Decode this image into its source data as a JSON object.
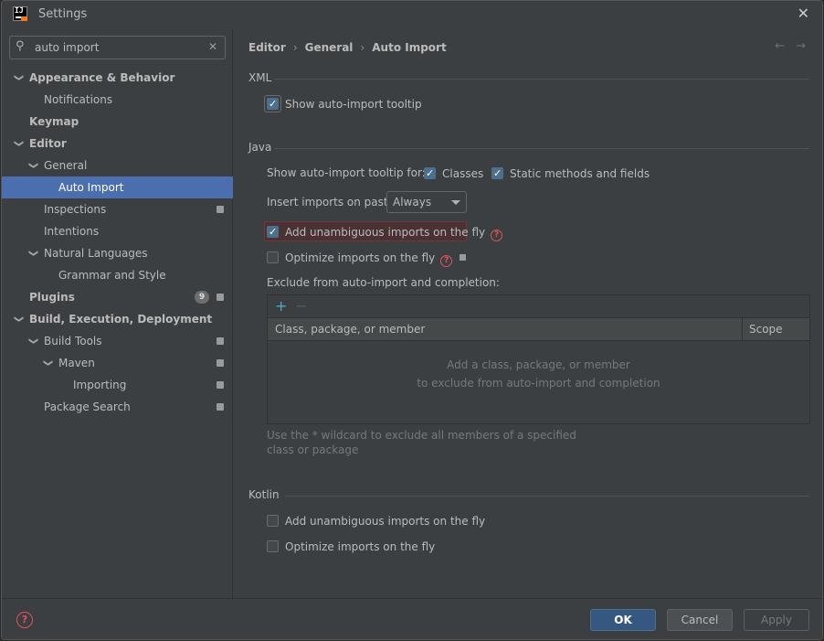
{
  "window": {
    "title": "Settings",
    "app_icon_text": "IJ"
  },
  "search": {
    "value": "auto import"
  },
  "tree": [
    {
      "label": "Appearance & Behavior",
      "bold": true,
      "chevron": true,
      "level": 0,
      "selected": false,
      "project": false,
      "badge": ""
    },
    {
      "label": "Notifications",
      "bold": false,
      "chevron": false,
      "level": 1,
      "selected": false,
      "project": false,
      "badge": ""
    },
    {
      "label": "Keymap",
      "bold": true,
      "chevron": false,
      "level": 0,
      "selected": false,
      "project": false,
      "badge": ""
    },
    {
      "label": "Editor",
      "bold": true,
      "chevron": true,
      "level": 0,
      "selected": false,
      "project": false,
      "badge": ""
    },
    {
      "label": "General",
      "bold": false,
      "chevron": true,
      "level": 1,
      "selected": false,
      "project": false,
      "badge": ""
    },
    {
      "label": "Auto Import",
      "bold": false,
      "chevron": false,
      "level": 2,
      "selected": true,
      "project": false,
      "badge": ""
    },
    {
      "label": "Inspections",
      "bold": false,
      "chevron": false,
      "level": 1,
      "selected": false,
      "project": true,
      "badge": ""
    },
    {
      "label": "Intentions",
      "bold": false,
      "chevron": false,
      "level": 1,
      "selected": false,
      "project": false,
      "badge": ""
    },
    {
      "label": "Natural Languages",
      "bold": false,
      "chevron": true,
      "level": 1,
      "selected": false,
      "project": false,
      "badge": ""
    },
    {
      "label": "Grammar and Style",
      "bold": false,
      "chevron": false,
      "level": 2,
      "selected": false,
      "project": false,
      "badge": ""
    },
    {
      "label": "Plugins",
      "bold": true,
      "chevron": false,
      "level": 0,
      "selected": false,
      "project": true,
      "badge": "9"
    },
    {
      "label": "Build, Execution, Deployment",
      "bold": true,
      "chevron": true,
      "level": 0,
      "selected": false,
      "project": false,
      "badge": ""
    },
    {
      "label": "Build Tools",
      "bold": false,
      "chevron": true,
      "level": 1,
      "selected": false,
      "project": true,
      "badge": ""
    },
    {
      "label": "Maven",
      "bold": false,
      "chevron": true,
      "level": 2,
      "selected": false,
      "project": true,
      "badge": ""
    },
    {
      "label": "Importing",
      "bold": false,
      "chevron": false,
      "level": 3,
      "selected": false,
      "project": true,
      "badge": ""
    },
    {
      "label": "Package Search",
      "bold": false,
      "chevron": false,
      "level": 1,
      "selected": false,
      "project": true,
      "badge": ""
    }
  ],
  "breadcrumb": {
    "items": [
      "Editor",
      "General",
      "Auto Import"
    ],
    "separator": "›"
  },
  "nav": {
    "back": "←",
    "forward": "→"
  },
  "xml": {
    "title": "XML",
    "show_tooltip": {
      "label": "Show auto-import tooltip",
      "checked": true
    }
  },
  "java": {
    "title": "Java",
    "tooltip_for_label": "Show auto-import tooltip for:",
    "classes": {
      "label": "Classes",
      "checked": true
    },
    "static_methods": {
      "label": "Static methods and fields",
      "checked": true
    },
    "insert_on_paste_label": "Insert imports on paste:",
    "insert_on_paste_value": "Always",
    "add_unambiguous": {
      "label": "Add unambiguous imports on the fly",
      "checked": true
    },
    "optimize": {
      "label": "Optimize imports on the fly",
      "checked": false
    },
    "exclude_label": "Exclude from auto-import and completion:",
    "table": {
      "add": "+",
      "remove": "−",
      "col_member": "Class, package, or member",
      "col_scope": "Scope",
      "empty_line1": "Add a class, package, or member",
      "empty_line2": "to exclude from auto-import and completion"
    },
    "hint": "Use the * wildcard to exclude all members of a specified class or package"
  },
  "kotlin": {
    "title": "Kotlin",
    "add_unambiguous": {
      "label": "Add unambiguous imports on the fly",
      "checked": false
    },
    "optimize": {
      "label": "Optimize imports on the fly",
      "checked": false
    }
  },
  "footer": {
    "ok": "OK",
    "cancel": "Cancel",
    "apply": "Apply",
    "help": "?"
  },
  "colors": {
    "accent": "#4b6eaf",
    "primary_button": "#365880",
    "error": "#e0525d",
    "background": "#3c3f41"
  }
}
